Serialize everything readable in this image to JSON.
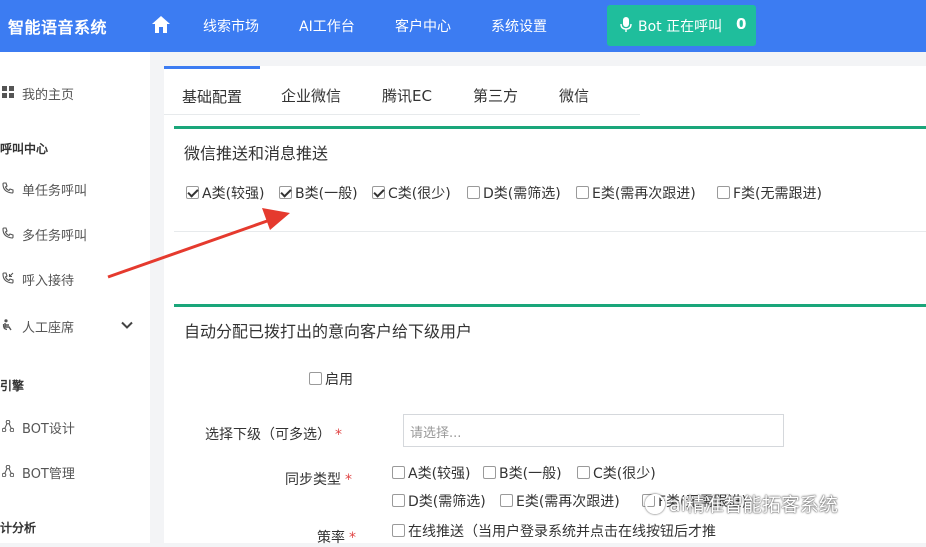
{
  "header": {
    "brand": "智能语音系统",
    "nav": [
      "线索市场",
      "AI工作台",
      "客户中心",
      "系统设置"
    ],
    "bot_label": "Bot 正在呼叫",
    "bot_count": "0"
  },
  "sidebar": {
    "items": [
      {
        "label": "我的主页",
        "icon": "grid-icon"
      },
      {
        "group": "呼叫中心"
      },
      {
        "label": "单任务呼叫",
        "icon": "phone-icon"
      },
      {
        "label": "多任务呼叫",
        "icon": "phone-icon"
      },
      {
        "label": "呼入接待",
        "icon": "phone-incoming-icon"
      },
      {
        "label": "人工座席",
        "icon": "seat-icon"
      },
      {
        "group": "引擎"
      },
      {
        "label": "BOT设计",
        "icon": "nodes-icon"
      },
      {
        "label": "BOT管理",
        "icon": "nodes-icon"
      },
      {
        "group": "计分析"
      }
    ]
  },
  "tabs": [
    "基础配置",
    "企业微信",
    "腾讯EC",
    "第三方",
    "微信"
  ],
  "wechat_section": {
    "title": "微信推送和消息推送",
    "options": [
      {
        "label": "A类(较强)",
        "checked": true
      },
      {
        "label": "B类(一般)",
        "checked": true
      },
      {
        "label": "C类(很少)",
        "checked": true
      },
      {
        "label": "D类(需筛选)",
        "checked": false
      },
      {
        "label": "E类(需再次跟进)",
        "checked": false
      },
      {
        "label": "F类(无需跟进)",
        "checked": false
      }
    ]
  },
  "assign_section": {
    "title": "自动分配已拨打出的意向客户给下级用户",
    "enable_label": "启用",
    "select_label": "选择下级（可多选）",
    "select_placeholder": "请选择...",
    "sync_label": "同步类型",
    "sync_options": [
      {
        "label": "A类(较强)",
        "checked": false
      },
      {
        "label": "B类(一般)",
        "checked": false
      },
      {
        "label": "C类(很少)",
        "checked": false
      },
      {
        "label": "D类(需筛选)",
        "checked": false
      },
      {
        "label": "E类(需再次跟进)",
        "checked": false
      },
      {
        "label": "F类(无需跟进)",
        "checked": false
      }
    ],
    "strategy_label": "策率",
    "strategy_option": "在线推送（当用户登录系统并点击在线按钮后才推"
  },
  "required_mark": "*",
  "watermark": "ai精准智能拓客系统",
  "colors": {
    "header": "#3c7cf2",
    "bot_button": "#1fbe9c",
    "section_accent": "#1aa67a",
    "annotation_arrow": "#e53a2e"
  }
}
